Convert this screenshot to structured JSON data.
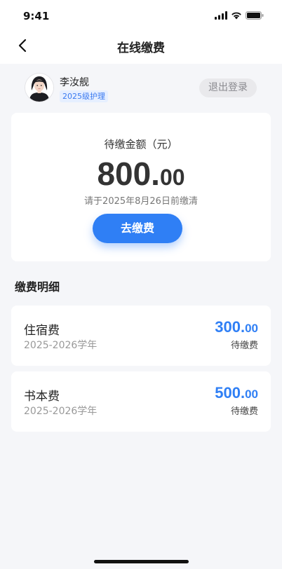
{
  "status_bar": {
    "time": "9:41"
  },
  "header": {
    "title": "在线缴费"
  },
  "user": {
    "name": "李汝舰",
    "badge": "2025级护理",
    "logout_label": "退出登录"
  },
  "summary": {
    "label": "待缴金额（元）",
    "amount_integer": "800.",
    "amount_decimal": "00",
    "deadline": "请于2025年8月26日前缴清",
    "pay_button_label": "去缴费"
  },
  "details": {
    "section_title": "缴费明细",
    "items": [
      {
        "name": "住宿费",
        "term": "2025-2026学年",
        "amount_integer": "300.",
        "amount_decimal": "00",
        "status": "待缴费"
      },
      {
        "name": "书本费",
        "term": "2025-2026学年",
        "amount_integer": "500.",
        "amount_decimal": "00",
        "status": "待缴费"
      }
    ]
  },
  "colors": {
    "accent": "#2f7ff5",
    "background": "#f5f6f9",
    "card": "#ffffff"
  },
  "icons": [
    "back-icon",
    "signal-icon",
    "wifi-icon",
    "battery-icon",
    "avatar"
  ]
}
